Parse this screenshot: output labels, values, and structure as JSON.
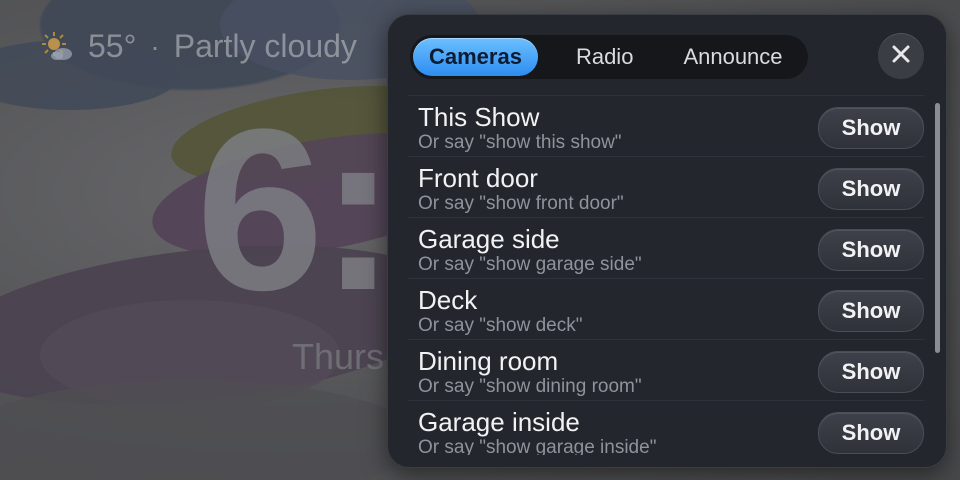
{
  "background": {
    "weather": {
      "icon": "partly-cloudy-icon",
      "temperature": "55°",
      "separator": "·",
      "condition": "Partly cloudy"
    },
    "clock": "6:",
    "date": "Thurs"
  },
  "panel": {
    "tabs": [
      {
        "label": "Cameras",
        "active": true
      },
      {
        "label": "Radio",
        "active": false
      },
      {
        "label": "Announce",
        "active": false
      }
    ],
    "close_icon": "close-icon",
    "cameras": [
      {
        "title": "This Show",
        "hint": "Or say \"show this show\"",
        "button": "Show"
      },
      {
        "title": "Front door",
        "hint": "Or say \"show front door\"",
        "button": "Show"
      },
      {
        "title": "Garage side",
        "hint": "Or say \"show garage side\"",
        "button": "Show"
      },
      {
        "title": "Deck",
        "hint": "Or say \"show deck\"",
        "button": "Show"
      },
      {
        "title": "Dining room",
        "hint": "Or say \"show dining room\"",
        "button": "Show"
      },
      {
        "title": "Garage inside",
        "hint": "Or say \"show garage inside\"",
        "button": "Show"
      }
    ]
  },
  "colors": {
    "accent": "#3a9bf5",
    "panel_bg": "#23262c"
  }
}
